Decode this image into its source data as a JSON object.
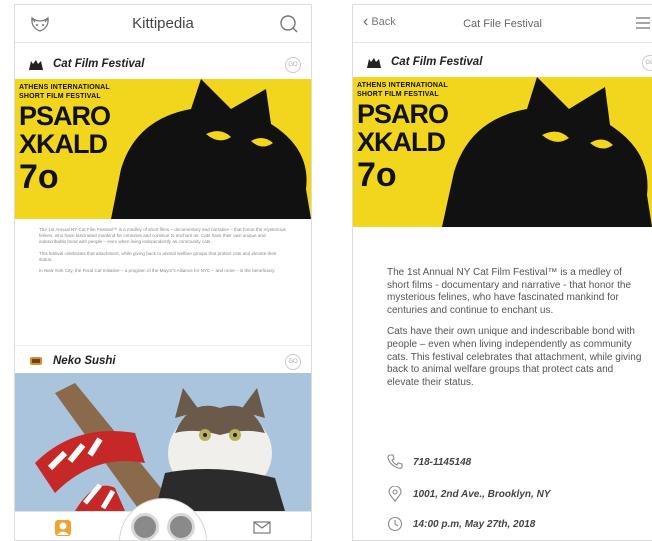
{
  "left": {
    "header": {
      "title": "Kittipedia"
    },
    "cards": [
      {
        "title": "Cat Film Festival",
        "badge": "GO",
        "poster": {
          "line1": "ATHENS INTERNATIONAL",
          "line2": "SHORT FILM FESTIVAL",
          "big1": "PSARO",
          "big2": "XKALD",
          "num": "7o"
        },
        "blurb": [
          "The 1st Annual NY Cat Film Festival™ is a medley of short films – documentary and narrative – that honor the mysterious felines, who have fascinated mankind for centuries and continue to enchant us. Cats have their own unique and indescribable bond with people – even when living independently as community cats.",
          "This festival celebrates that attachment, while giving back to animal welfare groups that protect cats and elevate their status.",
          "In New York City, the Feral Cat Initiative – a program of the Mayor's Alliance for NYC – and more – is the beneficiary."
        ]
      },
      {
        "title": "Neko Sushi",
        "badge": "GO"
      }
    ]
  },
  "right": {
    "header": {
      "back_label": "Back",
      "title": "Cat File Festival"
    },
    "card": {
      "title": "Cat Film Festival",
      "badge": "GO",
      "poster": {
        "line1": "ATHENS INTERNATIONAL",
        "line2": "SHORT FILM FESTIVAL",
        "big1": "PSARO",
        "big2": "XKALD",
        "num": "7o"
      }
    },
    "paragraphs": [
      "The 1st Annual NY Cat Film Festival™ is a medley of short films - documentary and narrative - that honor the mysterious felines, who have fascinated mankind for centuries and continue to enchant us.",
      "Cats have their own unique and indescribable bond with people – even when living independently as community cats. This festival celebrates that attachment, while giving back to animal welfare groups that protect cats and elevate their status."
    ],
    "info": {
      "phone": "718-1145148",
      "address": "1001, 2nd Ave., Brooklyn, NY",
      "time": "14:00 p.m, May 27th, 2018"
    }
  },
  "colors": {
    "poster_yellow": "#f2d61d",
    "sushi_bg": "#a9c4dc"
  }
}
